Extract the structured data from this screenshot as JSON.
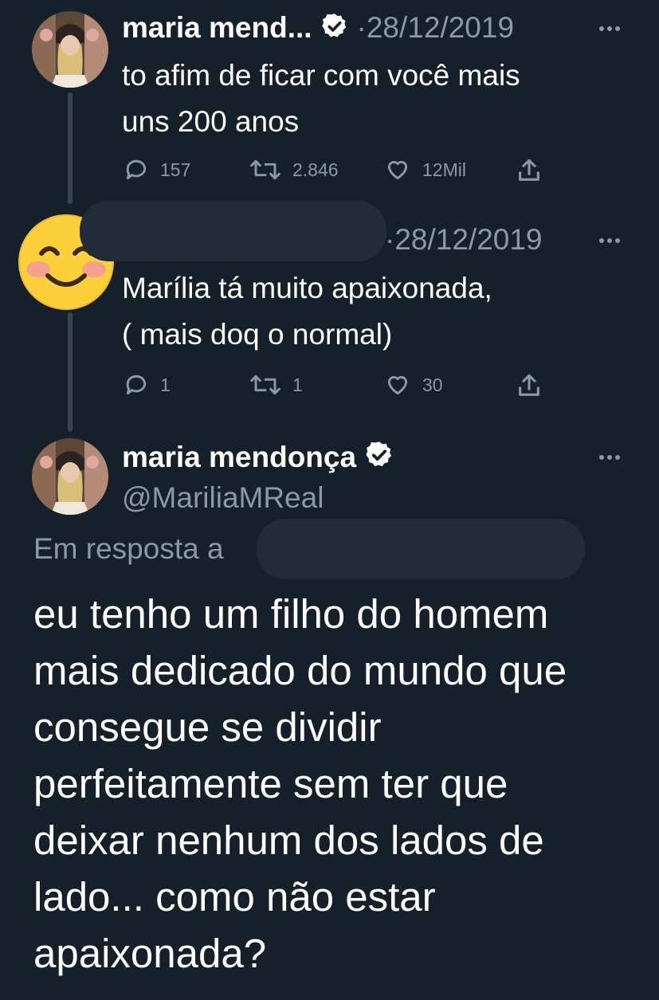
{
  "tweets": [
    {
      "author_name": "maria mend...",
      "verified_icon": "verified-badge-icon",
      "date": "·28/12/2019",
      "text_lines": [
        "to afim de ficar com você mais",
        "uns 200 anos"
      ],
      "actions": {
        "replies": "157",
        "retweets": "2.846",
        "likes": "12Mil"
      }
    },
    {
      "author_avatar": "smiling-face-emoji",
      "date": "·28/12/2019",
      "text_lines": [
        "Marília tá muito apaixonada,",
        "( mais doq o normal)"
      ],
      "actions": {
        "replies": "1",
        "retweets": "1",
        "likes": "30"
      }
    }
  ],
  "main_tweet": {
    "author_name": "maria mendonça",
    "handle": "@MariliaMReal",
    "reply_to_label": "Em resposta a",
    "text_lines": [
      "eu tenho um filho do homem",
      "mais dedicado do mundo que",
      "consegue se dividir",
      "perfeitamente sem ter que",
      "deixar nenhum dos lados de",
      "lado... como não estar",
      "apaixonada?"
    ]
  },
  "colors": {
    "background": "#15202b",
    "text": "#ffffff",
    "muted": "#8b98a5",
    "thread_line": "#38444d"
  }
}
